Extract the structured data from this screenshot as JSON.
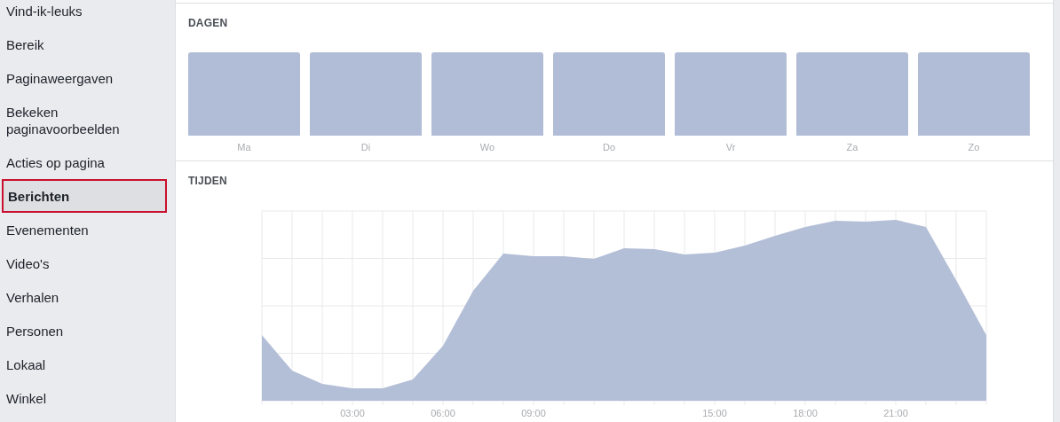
{
  "sidebar": {
    "items": [
      {
        "label": "Vind-ik-leuks",
        "selected": false
      },
      {
        "label": "Bereik",
        "selected": false
      },
      {
        "label": "Paginaweergaven",
        "selected": false
      },
      {
        "label": "Bekeken paginavoorbeelden",
        "selected": false
      },
      {
        "label": "Acties op pagina",
        "selected": false
      },
      {
        "label": "Berichten",
        "selected": true
      },
      {
        "label": "Evenementen",
        "selected": false
      },
      {
        "label": "Video's",
        "selected": false
      },
      {
        "label": "Verhalen",
        "selected": false
      },
      {
        "label": "Personen",
        "selected": false
      },
      {
        "label": "Lokaal",
        "selected": false
      },
      {
        "label": "Winkel",
        "selected": false
      }
    ]
  },
  "days": {
    "title": "DAGEN",
    "bars": [
      {
        "label": "Ma"
      },
      {
        "label": "Di"
      },
      {
        "label": "Wo"
      },
      {
        "label": "Do"
      },
      {
        "label": "Vr"
      },
      {
        "label": "Za"
      },
      {
        "label": "Zo"
      }
    ]
  },
  "times": {
    "title": "TIJDEN",
    "xlabels": [
      "03:00",
      "06:00",
      "09:00",
      "15:00",
      "18:00",
      "21:00"
    ]
  }
}
